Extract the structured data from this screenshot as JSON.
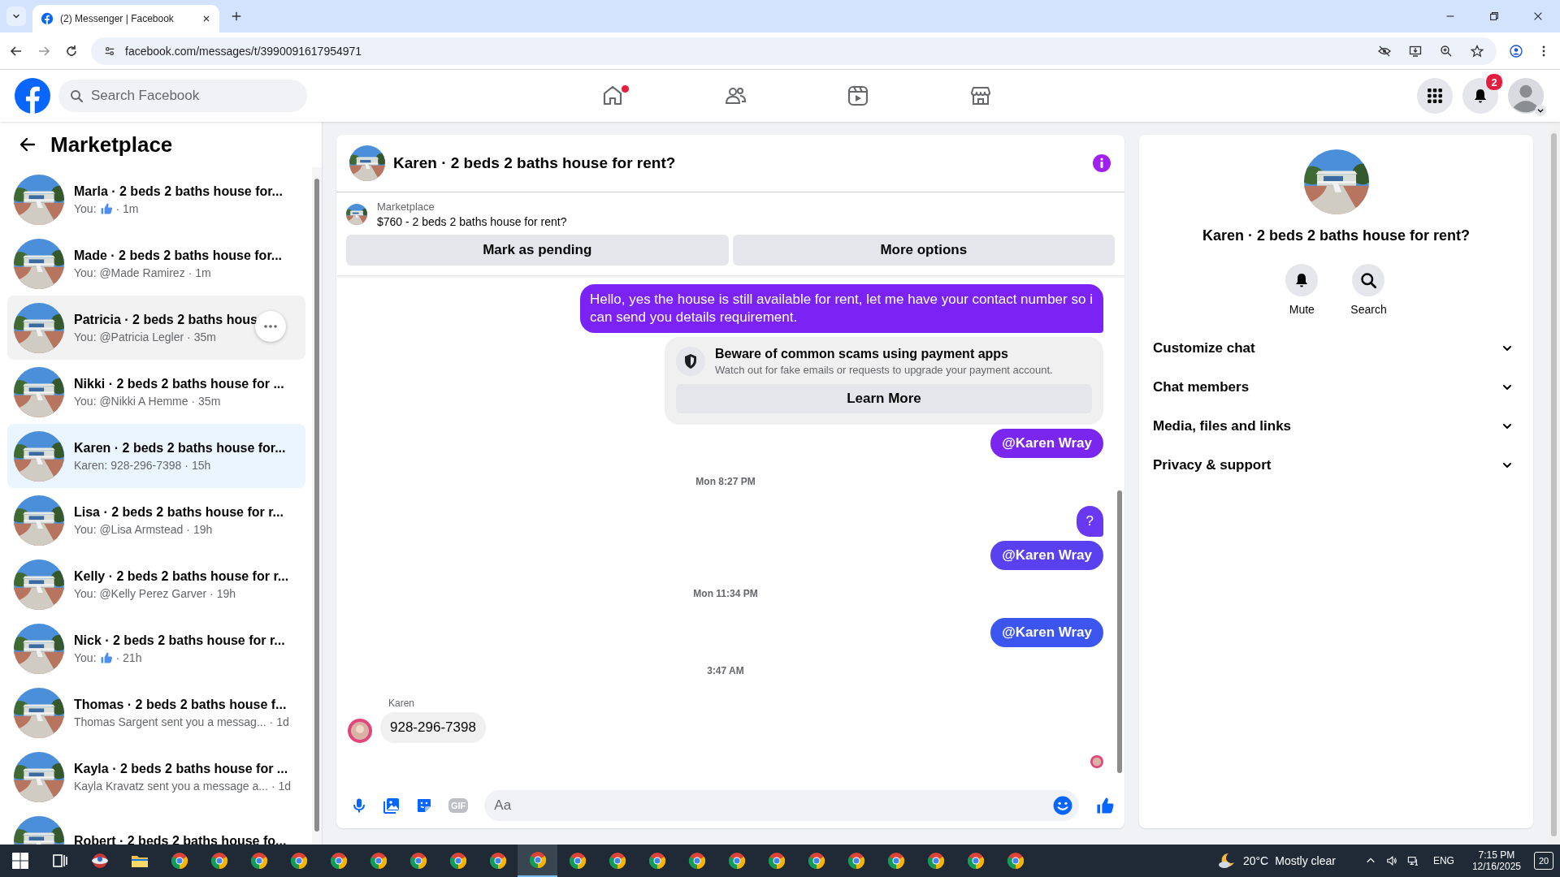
{
  "browser": {
    "tab_title": "(2) Messenger | Facebook",
    "url": "facebook.com/messages/t/3990091617954971"
  },
  "header": {
    "search": {
      "placeholder": "Search Facebook"
    },
    "nav": [
      {
        "kind": "home",
        "alert": true
      },
      {
        "kind": "friends",
        "alert": false
      },
      {
        "kind": "video",
        "alert": false
      },
      {
        "kind": "marketplace",
        "alert": false
      }
    ],
    "notifications_badge": "2"
  },
  "sidebar": {
    "title": "Marketplace",
    "conversations": [
      {
        "title": "Marla · 2 beds 2 baths house for...",
        "preview": "You:",
        "like": true,
        "time": "· 1m",
        "selected": false,
        "hovered": false
      },
      {
        "title": "Made · 2 beds 2 baths house for...",
        "preview": "You: @Made Ramirez",
        "like": false,
        "time": "· 1m",
        "selected": false,
        "hovered": false
      },
      {
        "title": "Patricia · 2 beds 2 baths hous",
        "preview": "You: @Patricia Legler",
        "like": false,
        "time": "· 35m",
        "selected": false,
        "hovered": true
      },
      {
        "title": "Nikki · 2 beds 2 baths house for ...",
        "preview": "You: @Nikki A Hemme",
        "like": false,
        "time": "· 35m",
        "selected": false,
        "hovered": false
      },
      {
        "title": "Karen · 2 beds 2 baths house for...",
        "preview": "Karen: 928-296-7398",
        "like": false,
        "time": "· 15h",
        "selected": true,
        "hovered": false
      },
      {
        "title": "Lisa · 2 beds 2 baths house for r...",
        "preview": "You: @Lisa Armstead",
        "like": false,
        "time": "· 19h",
        "selected": false,
        "hovered": false
      },
      {
        "title": "Kelly · 2 beds 2 baths house for r...",
        "preview": "You: @Kelly Perez Garver",
        "like": false,
        "time": "· 19h",
        "selected": false,
        "hovered": false
      },
      {
        "title": "Nick · 2 beds 2 baths house for r...",
        "preview": "You:",
        "like": true,
        "time": "· 21h",
        "selected": false,
        "hovered": false
      },
      {
        "title": "Thomas · 2 beds 2 baths house f...",
        "preview": "Thomas Sargent sent you a messag...",
        "like": false,
        "time": "· 1d",
        "selected": false,
        "hovered": false
      },
      {
        "title": "Kayla · 2 beds 2 baths house for ...",
        "preview": "Kayla Kravatz sent you a message a...",
        "like": false,
        "time": "· 1d",
        "selected": false,
        "hovered": false
      },
      {
        "title": "Robert · 2 beds 2 baths house fo...",
        "selected": false,
        "hovered": false
      }
    ]
  },
  "chat": {
    "title": "Karen · 2 beds 2 baths house for rent?",
    "listing": {
      "label": "Marketplace",
      "title": "$760 - 2 beds 2 baths house for rent?",
      "buttons": [
        "Mark as pending",
        "More options"
      ]
    },
    "messages": [
      {
        "kind": "outgoing",
        "text": "Hello, yes the house is still available for rent, let me have your contact number so i can send you details requirement.",
        "color": "#7b22f5"
      },
      {
        "kind": "notice",
        "title": "Beware of common scams using payment apps",
        "text": "Watch out for fake emails or requests to upgrade your payment account.",
        "button": "Learn More"
      },
      {
        "kind": "mention",
        "text": "@Karen Wray",
        "color": "#7a26ef"
      },
      {
        "kind": "timestamp",
        "text": "Mon 8:27 PM"
      },
      {
        "kind": "outgoing",
        "text": "?",
        "color": "#6a37f2"
      },
      {
        "kind": "mention",
        "text": "@Karen Wray",
        "color": "#5a41f0"
      },
      {
        "kind": "timestamp",
        "text": "Mon 11:34 PM"
      },
      {
        "kind": "mention",
        "text": "@Karen Wray",
        "color": "#3c55ee"
      },
      {
        "kind": "timestamp",
        "text": "3:47 AM"
      },
      {
        "kind": "incoming",
        "sender": "Karen",
        "text": "928-296-7398"
      }
    ],
    "composer": {
      "placeholder": "Aa",
      "gif_label": "GIF"
    }
  },
  "details": {
    "title": "Karen · 2 beds 2 baths house for rent?",
    "actions": [
      {
        "kind": "mute",
        "label": "Mute"
      },
      {
        "kind": "search",
        "label": "Search"
      }
    ],
    "sections": [
      {
        "label": "Customize chat",
        "expanded": false
      },
      {
        "label": "Chat members",
        "expanded": false
      },
      {
        "label": "Media, files and links",
        "expanded": false
      },
      {
        "label": "Privacy & support",
        "expanded": false
      }
    ]
  },
  "taskbar": {
    "apps": [
      {
        "kind": "start",
        "selected": false
      },
      {
        "kind": "task-view",
        "selected": false
      },
      {
        "kind": "app",
        "selected": false
      },
      {
        "kind": "files",
        "selected": false
      },
      {
        "kind": "chrome",
        "selected": false
      },
      {
        "kind": "chrome",
        "selected": false
      },
      {
        "kind": "chrome",
        "selected": false
      },
      {
        "kind": "chrome",
        "selected": false
      },
      {
        "kind": "chrome",
        "selected": false
      },
      {
        "kind": "chrome",
        "selected": false
      },
      {
        "kind": "chrome",
        "selected": false
      },
      {
        "kind": "chrome",
        "selected": false
      },
      {
        "kind": "chrome",
        "selected": false
      },
      {
        "kind": "chrome",
        "selected": true
      },
      {
        "kind": "chrome",
        "selected": false
      },
      {
        "kind": "chrome",
        "selected": false
      },
      {
        "kind": "chrome",
        "selected": false
      },
      {
        "kind": "chrome",
        "selected": false
      },
      {
        "kind": "chrome",
        "selected": false
      },
      {
        "kind": "chrome",
        "selected": false
      },
      {
        "kind": "chrome",
        "selected": false
      },
      {
        "kind": "chrome",
        "selected": false
      },
      {
        "kind": "chrome",
        "selected": false
      },
      {
        "kind": "chrome",
        "selected": false
      },
      {
        "kind": "chrome",
        "selected": false
      },
      {
        "kind": "chrome",
        "selected": false
      }
    ],
    "weather": {
      "temp": "20°C",
      "text": "Mostly clear"
    },
    "language": "ENG",
    "time": "7:15 PM",
    "date": "12/16/2025",
    "notifications": "20"
  }
}
